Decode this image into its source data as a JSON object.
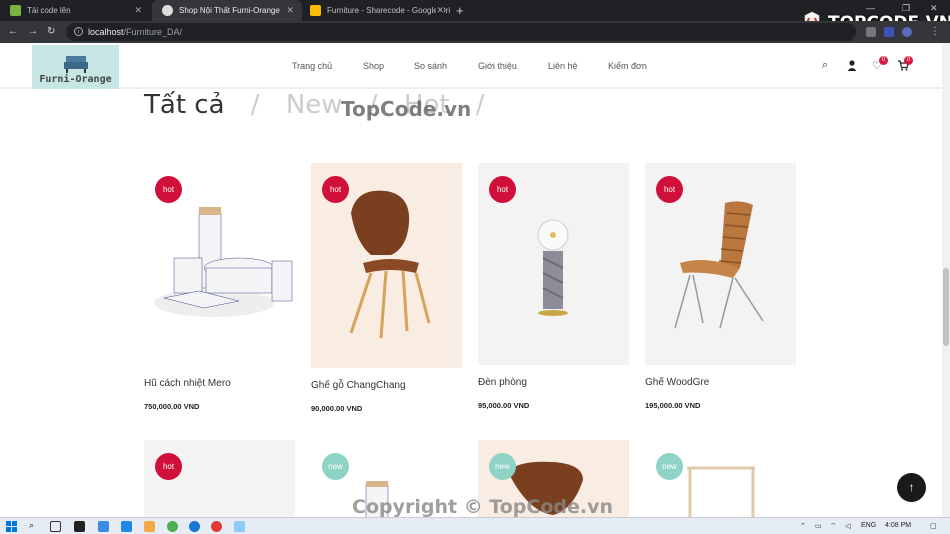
{
  "browser": {
    "tabs": [
      {
        "title": "Tải code lên",
        "active": false
      },
      {
        "title": "Shop Nội Thất Furni-Orange",
        "active": true
      },
      {
        "title": "Furniture - Sharecode - Google Dri",
        "active": false
      }
    ],
    "url_host": "localhost",
    "url_path": "/Furniture_DA/"
  },
  "site": {
    "logo": "Furni-Orange",
    "nav": [
      "Trang chủ",
      "Shop",
      "So sánh",
      "Giới thiệu",
      "Liên hệ",
      "Kiểm đơn"
    ],
    "wishlist_count": "0",
    "cart_count": "0"
  },
  "filters": {
    "all": "Tất cả",
    "sep": "/",
    "new": "New",
    "hot": "Hot"
  },
  "watermark": {
    "top": "TopCode.vn",
    "bottom": "Copyright © TopCode.vn",
    "logo": "TOPCODE.VN"
  },
  "products": [
    {
      "badge": "hot",
      "name": "Hũ cách nhiệt Mero",
      "price": "750,000.00 VND",
      "bg": "#ffffff"
    },
    {
      "badge": "hot",
      "name": "Ghế gỗ ChangChang",
      "price": "90,000.00 VND",
      "bg": "#f9ece2"
    },
    {
      "badge": "hot",
      "name": "Đèn phòng",
      "price": "95,000.00 VND",
      "bg": "#f3f3f4"
    },
    {
      "badge": "hot",
      "name": "Ghế WoodGre",
      "price": "195,000.00 VND",
      "bg": "#f3f3f4"
    },
    {
      "badge": "hot",
      "name": "",
      "price": "",
      "bg": "#f3f3f4"
    },
    {
      "badge": "new",
      "name": "",
      "price": "",
      "bg": "#ffffff"
    },
    {
      "badge": "new",
      "name": "",
      "price": "",
      "bg": "#f9ece2"
    },
    {
      "badge": "new",
      "name": "",
      "price": "",
      "bg": "#ffffff"
    }
  ],
  "taskbar": {
    "lang": "ENG",
    "time": "4:08 PM"
  }
}
